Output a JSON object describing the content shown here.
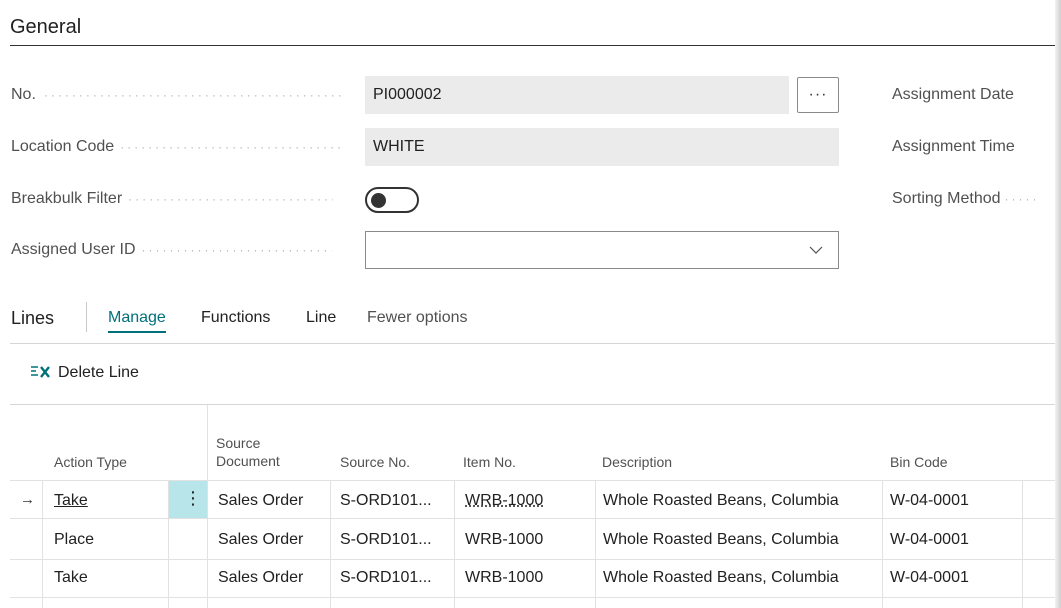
{
  "general": {
    "title": "General",
    "fields": {
      "no": {
        "label": "No.",
        "value": "PI000002",
        "assist": "···"
      },
      "location": {
        "label": "Location Code",
        "value": "WHITE"
      },
      "breakbulk": {
        "label": "Breakbulk Filter",
        "value": false
      },
      "assigned_user": {
        "label": "Assigned User ID",
        "value": ""
      }
    },
    "right_labels": {
      "assignment_date": "Assignment Date",
      "assignment_time": "Assignment Time",
      "sorting_method": "Sorting Method"
    }
  },
  "lines": {
    "title": "Lines",
    "tabs": [
      "Manage",
      "Functions",
      "Line",
      "Fewer options"
    ],
    "active_tab": "Manage",
    "delete_label": "Delete Line",
    "columns": {
      "action_type": "Action Type",
      "source_document_1": "Source",
      "source_document_2": "Document",
      "source_no": "Source No.",
      "item_no": "Item No.",
      "description": "Description",
      "bin_code": "Bin Code"
    },
    "rows": [
      {
        "indicator": "→",
        "action_type": "Take",
        "source_document": "Sales Order",
        "source_no": "S-ORD101...",
        "item_no": "WRB-1000",
        "description": "Whole Roasted Beans, Columbia",
        "bin_code": "W-04-0001"
      },
      {
        "indicator": "",
        "action_type": "Place",
        "source_document": "Sales Order",
        "source_no": "S-ORD101...",
        "item_no": "WRB-1000",
        "description": "Whole Roasted Beans, Columbia",
        "bin_code": "W-04-0001"
      },
      {
        "indicator": "",
        "action_type": "Take",
        "source_document": "Sales Order",
        "source_no": "S-ORD101...",
        "item_no": "WRB-1000",
        "description": "Whole Roasted Beans, Columbia",
        "bin_code": "W-04-0001"
      }
    ],
    "row_menu": "⋮"
  },
  "colors": {
    "accent": "#00707a",
    "field_bg": "#ebebeb",
    "row_menu_bg": "#b8e5ea"
  }
}
